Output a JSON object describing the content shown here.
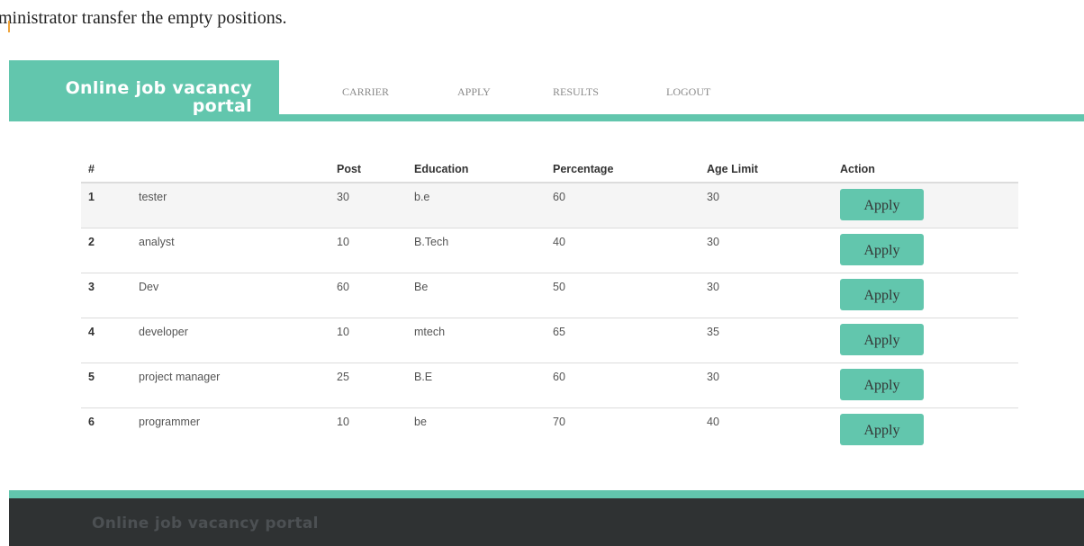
{
  "top_fragment": "ministrator transfer the empty positions.",
  "brand": {
    "line1": "Online job vacancy",
    "line2": "portal"
  },
  "nav": {
    "items": [
      "CARRIER",
      "APPLY",
      "RESULTS",
      "LOGOUT"
    ]
  },
  "table": {
    "headers": [
      "#",
      "",
      "Post",
      "Education",
      "Percentage",
      "Age Limit",
      "Action"
    ],
    "rows": [
      {
        "num": "1",
        "name": "tester",
        "post": "30",
        "education": "b.e",
        "percentage": "60",
        "age_limit": "30",
        "action": "Apply"
      },
      {
        "num": "2",
        "name": "analyst",
        "post": "10",
        "education": "B.Tech",
        "percentage": "40",
        "age_limit": "30",
        "action": "Apply"
      },
      {
        "num": "3",
        "name": "Dev",
        "post": "60",
        "education": "Be",
        "percentage": "50",
        "age_limit": "30",
        "action": "Apply"
      },
      {
        "num": "4",
        "name": "developer",
        "post": "10",
        "education": "mtech",
        "percentage": "65",
        "age_limit": "35",
        "action": "Apply"
      },
      {
        "num": "5",
        "name": "project manager",
        "post": "25",
        "education": "B.E",
        "percentage": "60",
        "age_limit": "30",
        "action": "Apply"
      },
      {
        "num": "6",
        "name": "programmer",
        "post": "10",
        "education": "be",
        "percentage": "70",
        "age_limit": "40",
        "action": "Apply"
      }
    ]
  },
  "footer": {
    "title": "Online job vacancy portal"
  },
  "colors": {
    "accent": "#62c6ad",
    "footer_bg": "#2f3233",
    "footer_text": "#4c5053",
    "stripe": "#f5f5f5"
  }
}
